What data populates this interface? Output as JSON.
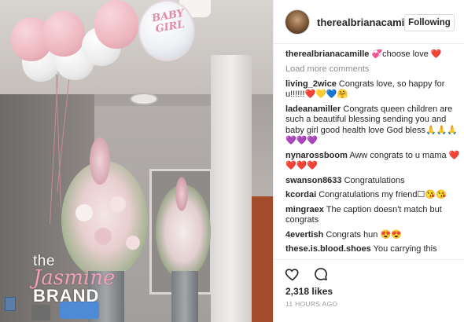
{
  "post": {
    "username": "therealbrianacamille",
    "follow_button": "Following",
    "caption": {
      "user": "therealbrianacamille",
      "text": "💞choose love ❤️"
    },
    "load_more": "Load more comments",
    "comments": [
      {
        "user": "living_2wice",
        "text": "Congrats love, so happy for u!!!!!!❤️💛💙🤗"
      },
      {
        "user": "ladeanamiller",
        "text": "Congrats queen children are such a beautiful blessing sending you and baby girl good health love God bless🙏🙏🙏💜💜💜"
      },
      {
        "user": "nynarossboom",
        "text": "Aww congrats to u mama ❤️❤️❤️❤️"
      },
      {
        "user": "swanson8633",
        "text": "Congratulations"
      },
      {
        "user": "kcordai",
        "text": "Congratulations my friend☐😘😘"
      },
      {
        "user": "mingraex",
        "text": "The caption doesn't match but congrats"
      },
      {
        "user": "4evertish",
        "text": "Congrats hun 😍😍"
      },
      {
        "user": "these.is.blood.shoes",
        "text": "You carrying this"
      }
    ],
    "likes": "2,318 likes",
    "timestamp": "11 HOURS AGO"
  },
  "photo": {
    "foil_balloon_text": "BABY GIRL",
    "watermark": {
      "line1": "the",
      "line2": "Jasmine",
      "line3": "BRAND"
    }
  },
  "icons": {
    "like": "heart-icon",
    "comment": "comment-bubble-icon"
  },
  "colors": {
    "accent_pink": "#eeb7bf",
    "watermark_pink": "#f2a0b8",
    "text": "#262626",
    "muted": "#8e8e8e"
  }
}
